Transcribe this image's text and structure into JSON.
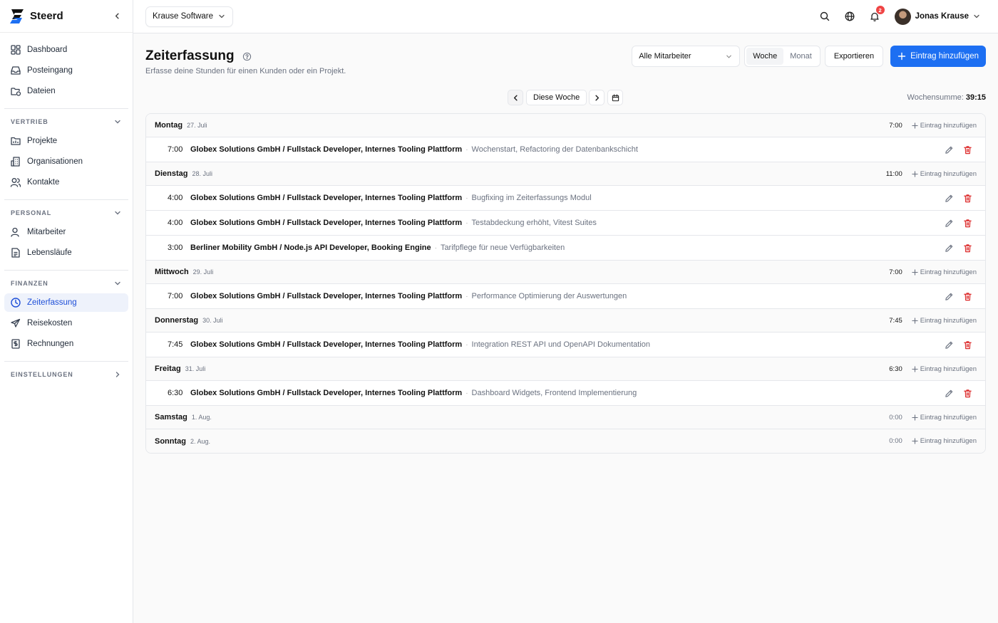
{
  "brand": {
    "name": "Steerd"
  },
  "sidebar": {
    "top_items": [
      {
        "label": "Dashboard",
        "icon": "dashboard-icon"
      },
      {
        "label": "Posteingang",
        "icon": "inbox-icon"
      },
      {
        "label": "Dateien",
        "icon": "files-icon"
      }
    ],
    "sections": [
      {
        "title": "VERTRIEB",
        "items": [
          {
            "label": "Projekte",
            "icon": "projects-icon"
          },
          {
            "label": "Organisationen",
            "icon": "organizations-icon"
          },
          {
            "label": "Kontakte",
            "icon": "contacts-icon"
          }
        ]
      },
      {
        "title": "PERSONAL",
        "items": [
          {
            "label": "Mitarbeiter",
            "icon": "employee-icon"
          },
          {
            "label": "Lebensläufe",
            "icon": "resume-icon"
          }
        ]
      },
      {
        "title": "FINANZEN",
        "items": [
          {
            "label": "Zeiterfassung",
            "icon": "clock-icon",
            "active": true
          },
          {
            "label": "Reisekosten",
            "icon": "plane-icon"
          },
          {
            "label": "Rechnungen",
            "icon": "invoice-icon"
          }
        ]
      },
      {
        "title": "EINSTELLUNGEN",
        "items": []
      }
    ]
  },
  "topbar": {
    "tenant": "Krause Software",
    "notification_count": "2",
    "user_name": "Jonas Krause"
  },
  "page": {
    "title": "Zeiterfassung",
    "subtitle": "Erfasse deine Stunden für einen Kunden oder ein Projekt.",
    "employee_filter": "Alle Mitarbeiter",
    "view_week": "Woche",
    "view_month": "Monat",
    "active_view": "Woche",
    "export_label": "Exportieren",
    "add_label": "Eintrag hinzufügen",
    "week_label": "Diese Woche",
    "week_sum_label": "Wochensumme:",
    "week_sum_value": "39:15",
    "day_add_label": "Eintrag hinzufügen"
  },
  "days": [
    {
      "name": "Montag",
      "date": "27. Juli",
      "total": "7:00",
      "entries": [
        {
          "time": "7:00",
          "project": "Globex Solutions GmbH / Fullstack Developer, Internes Tooling Plattform",
          "description": "Wochenstart, Refactoring der Datenbankschicht"
        }
      ]
    },
    {
      "name": "Dienstag",
      "date": "28. Juli",
      "total": "11:00",
      "entries": [
        {
          "time": "4:00",
          "project": "Globex Solutions GmbH / Fullstack Developer, Internes Tooling Plattform",
          "description": "Bugfixing im Zeiterfassungs Modul"
        },
        {
          "time": "4:00",
          "project": "Globex Solutions GmbH / Fullstack Developer, Internes Tooling Plattform",
          "description": "Testabdeckung erhöht, Vitest Suites"
        },
        {
          "time": "3:00",
          "project": "Berliner Mobility GmbH / Node.js API Developer, Booking Engine",
          "description": "Tarifpflege für neue Verfügbarkeiten"
        }
      ]
    },
    {
      "name": "Mittwoch",
      "date": "29. Juli",
      "total": "7:00",
      "entries": [
        {
          "time": "7:00",
          "project": "Globex Solutions GmbH / Fullstack Developer, Internes Tooling Plattform",
          "description": "Performance Optimierung der Auswertungen"
        }
      ]
    },
    {
      "name": "Donnerstag",
      "date": "30. Juli",
      "total": "7:45",
      "entries": [
        {
          "time": "7:45",
          "project": "Globex Solutions GmbH / Fullstack Developer, Internes Tooling Plattform",
          "description": "Integration REST API und OpenAPI Dokumentation"
        }
      ]
    },
    {
      "name": "Freitag",
      "date": "31. Juli",
      "total": "6:30",
      "entries": [
        {
          "time": "6:30",
          "project": "Globex Solutions GmbH / Fullstack Developer, Internes Tooling Plattform",
          "description": "Dashboard Widgets, Frontend Implementierung"
        }
      ]
    },
    {
      "name": "Samstag",
      "date": "1. Aug.",
      "total": "0:00",
      "entries": []
    },
    {
      "name": "Sonntag",
      "date": "2. Aug.",
      "total": "0:00",
      "entries": []
    }
  ],
  "colors": {
    "accent": "#1d6ff2",
    "active_nav_bg": "#eef2fb",
    "active_nav_text": "#1d4ed8",
    "danger": "#dc2626",
    "badge": "#ef4444"
  }
}
